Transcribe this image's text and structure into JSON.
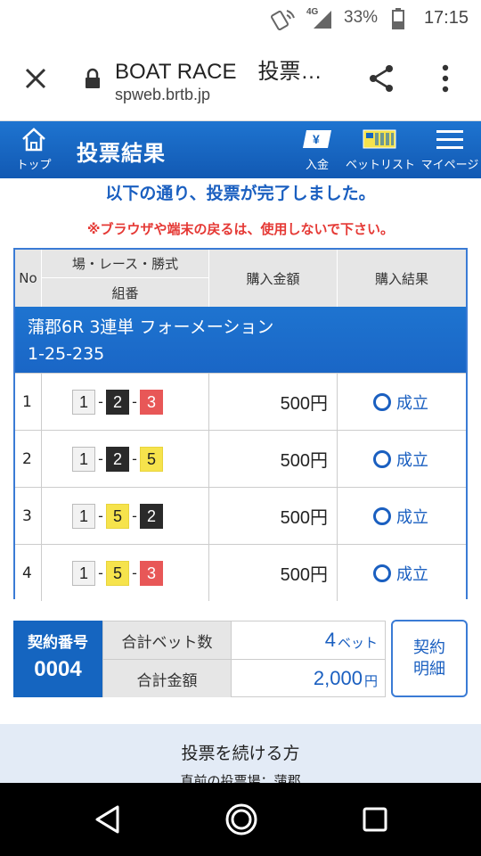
{
  "status_bar": {
    "network": "4G",
    "battery": "33%",
    "time": "17:15"
  },
  "browser": {
    "title": "BOAT RACE　投票…",
    "url": "spweb.brtb.jp"
  },
  "header": {
    "top_label": "トップ",
    "title": "投票結果",
    "deposit_label": "入金",
    "betlist_label": "ベットリスト",
    "mypage_label": "マイページ",
    "deposit_icon_text": "¥"
  },
  "messages": {
    "complete": "以下の通り、投票が完了しました。",
    "warning": "※ブラウザや端末の戻るは、使用しないで下さい。"
  },
  "table": {
    "headers": {
      "no": "No",
      "race": "場・レース・勝式",
      "combo": "組番",
      "amount": "購入金額",
      "result": "購入結果"
    },
    "race_line1": "蒲郡6R 3連単 フォーメーション",
    "race_line2": "1-25-235",
    "rows": [
      {
        "no": "1",
        "b1": "1",
        "b2": "2",
        "b3": "3",
        "amount": "500円",
        "result": "成立"
      },
      {
        "no": "2",
        "b1": "1",
        "b2": "2",
        "b3": "5",
        "amount": "500円",
        "result": "成立"
      },
      {
        "no": "3",
        "b1": "1",
        "b2": "5",
        "b3": "2",
        "amount": "500円",
        "result": "成立"
      },
      {
        "no": "4",
        "b1": "1",
        "b2": "5",
        "b3": "3",
        "amount": "500円",
        "result": "成立"
      }
    ]
  },
  "summary": {
    "contract_label": "契約番号",
    "contract_no": "0004",
    "bet_count_label": "合計ベット数",
    "bet_count": "4",
    "bet_unit": "ベット",
    "total_label": "合計金額",
    "total": "2,000",
    "total_unit": "円",
    "detail_line1": "契約",
    "detail_line2": "明細"
  },
  "continue": {
    "title": "投票を続ける方",
    "sub": "直前の投票場：蒲郡"
  },
  "colors": {
    "brand_blue": "#1565c0",
    "result_blue": "#1a5fc0",
    "warning_red": "#e53935"
  }
}
